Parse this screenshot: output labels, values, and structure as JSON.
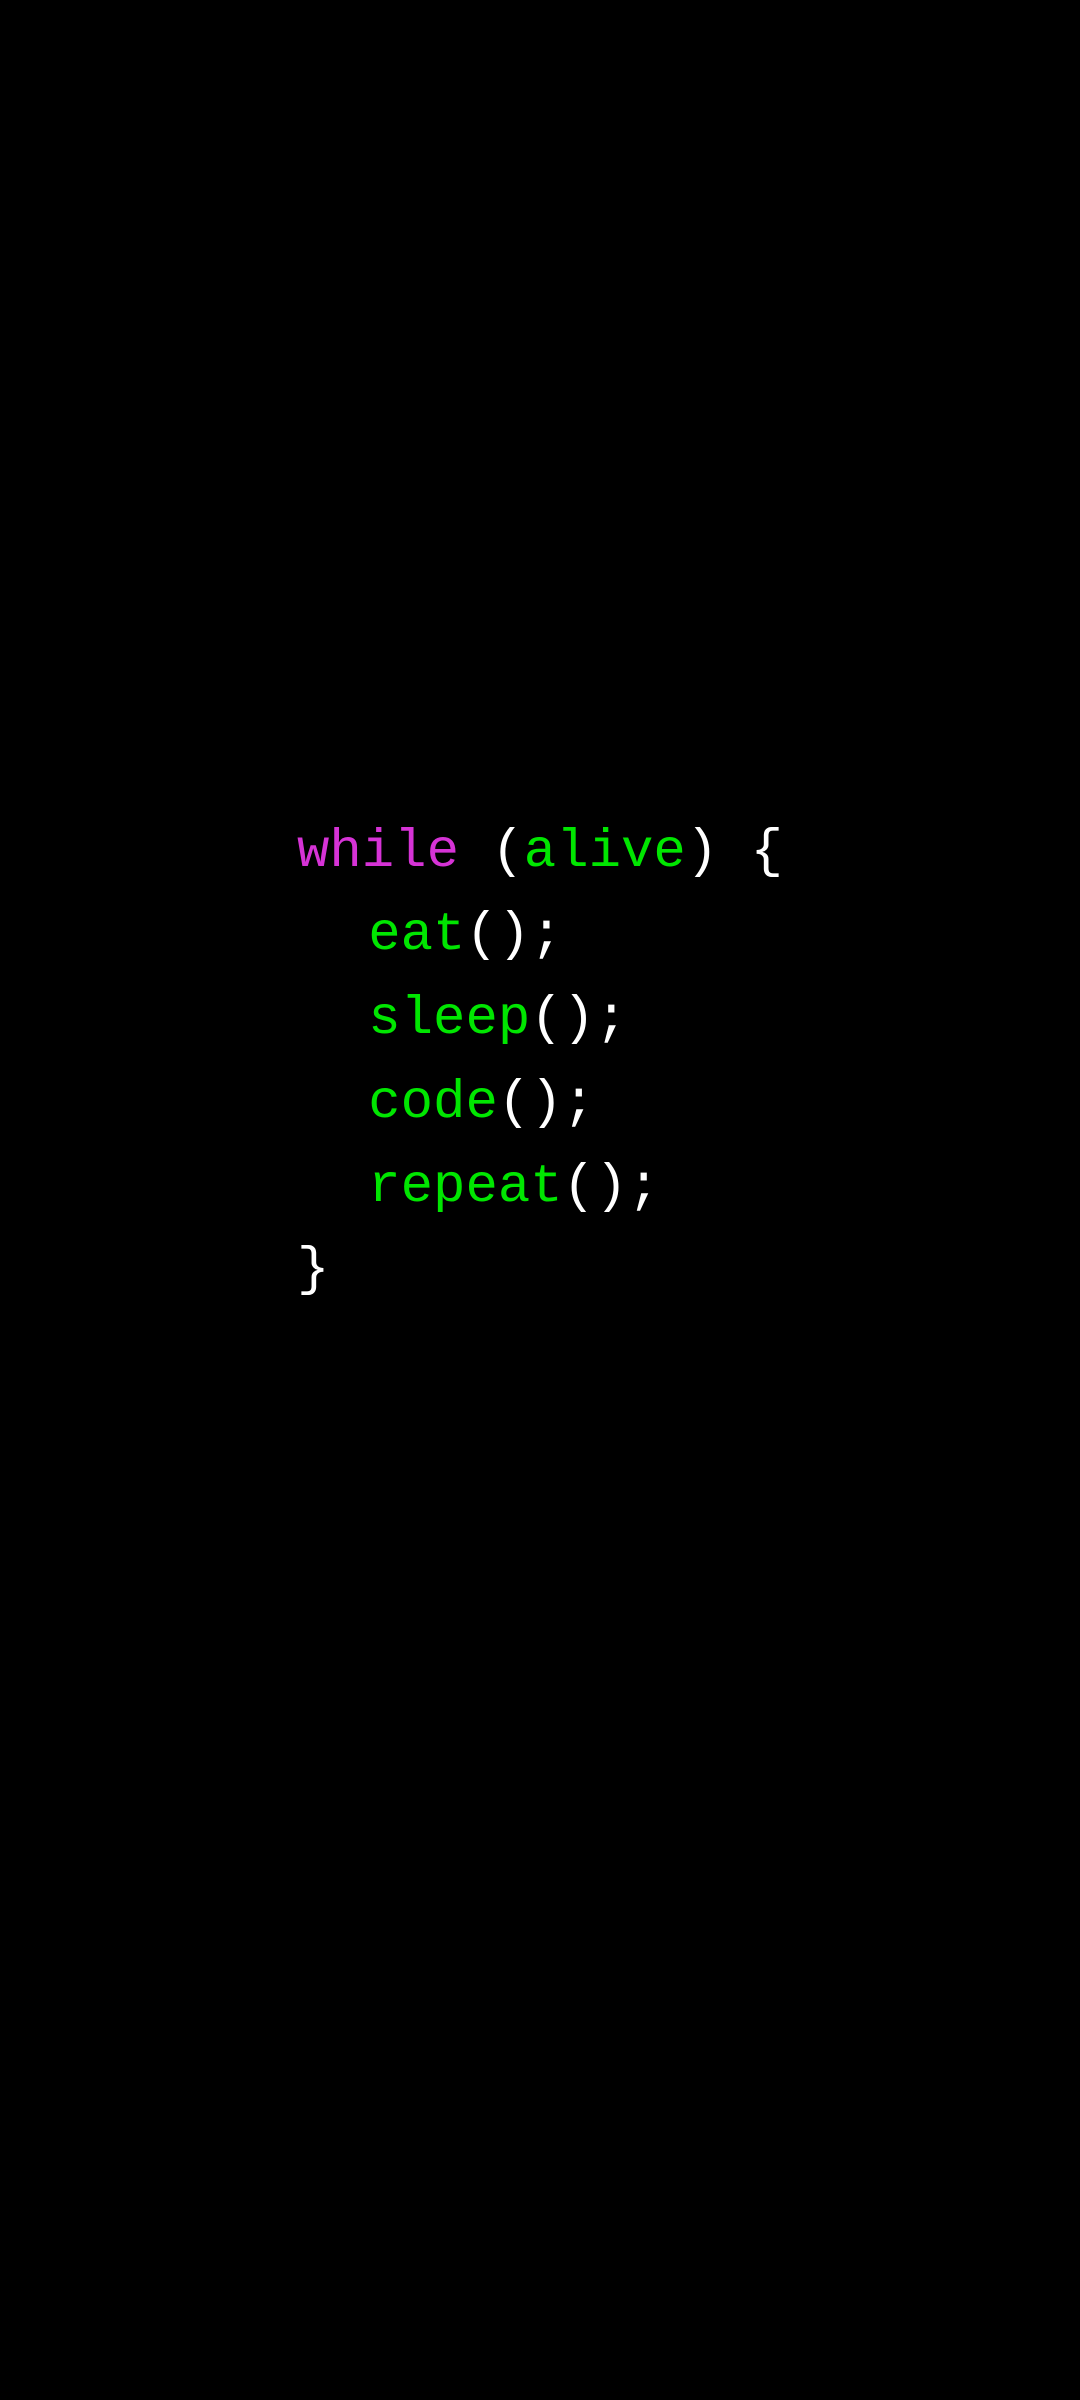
{
  "code": {
    "keyword": "while",
    "condition": "alive",
    "open_paren": " (",
    "close_paren": ") ",
    "open_brace": "{",
    "close_brace": "}",
    "call_suffix": "();",
    "statements": [
      "eat",
      "sleep",
      "code",
      "repeat"
    ]
  },
  "colors": {
    "keyword": "#d633d6",
    "identifier": "#00e600",
    "punctuation": "#ffffff",
    "background": "#000000"
  }
}
